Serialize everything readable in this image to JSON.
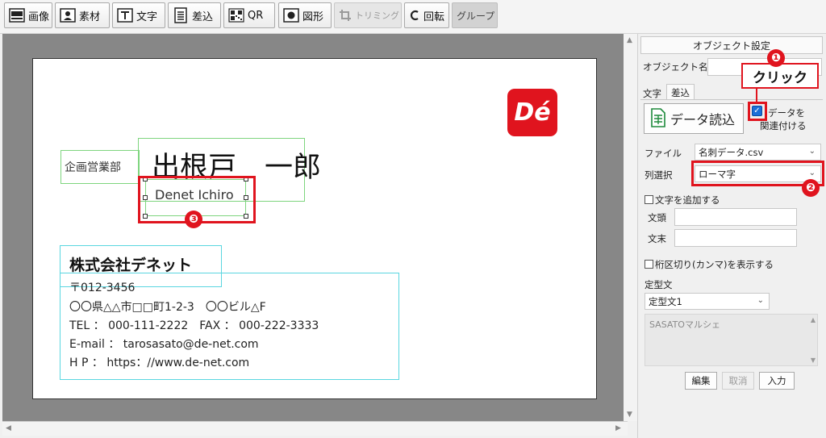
{
  "toolbar": {
    "image": "画像",
    "material": "素材",
    "text": "文字",
    "merge": "差込",
    "qr": "QR",
    "shape": "図形",
    "trimming": "トリミング",
    "rotate": "回転",
    "group": "グループ"
  },
  "card": {
    "department": "企画営業部",
    "name": "出根戸　一郎",
    "romaji": "Denet Ichiro",
    "logo": "Dé",
    "company": "株式会社デネット",
    "postal": "〒012-3456",
    "address": "〇〇県△△市□□町1-2-3　〇〇ビル△F",
    "phone": "TEL ： 000-111-2222　FAX ： 000-222-3333",
    "email": "E-mail ： tarosasato@de-net.com",
    "web": "H P ： https：//www.de-net.com"
  },
  "panel": {
    "header": "オブジェクト設定",
    "object_name_label": "オブジェクト名",
    "object_name_value": "",
    "tab_text": "文字",
    "tab_merge": "差込",
    "data_load_button": "データ読込",
    "link_data_line1": "データを",
    "link_data_line2": "関連付ける",
    "link_data_checked": true,
    "file_label": "ファイル",
    "file_value": "名刺データ.csv",
    "column_label": "列選択",
    "column_value": "ローマ字",
    "add_text_label": "文字を追加する",
    "prefix_label": "文頭",
    "prefix_value": "",
    "suffix_label": "文末",
    "suffix_value": "",
    "comma_label": "桁区切り(カンマ)を表示する",
    "template_label": "定型文",
    "template_value": "定型文1",
    "template_text": "SASATOマルシェ",
    "edit_button": "編集",
    "cancel_button": "取消",
    "input_button": "入力"
  },
  "annotations": {
    "callout_click": "クリック",
    "step1": "❶",
    "step2": "❷",
    "step3": "❸"
  },
  "colors": {
    "highlight_red": "#e0141e",
    "selection_green": "#7ed57e",
    "selection_cyan": "#5ad6e0",
    "logo_red": "#e0141e",
    "canvas_gray": "#878787"
  }
}
